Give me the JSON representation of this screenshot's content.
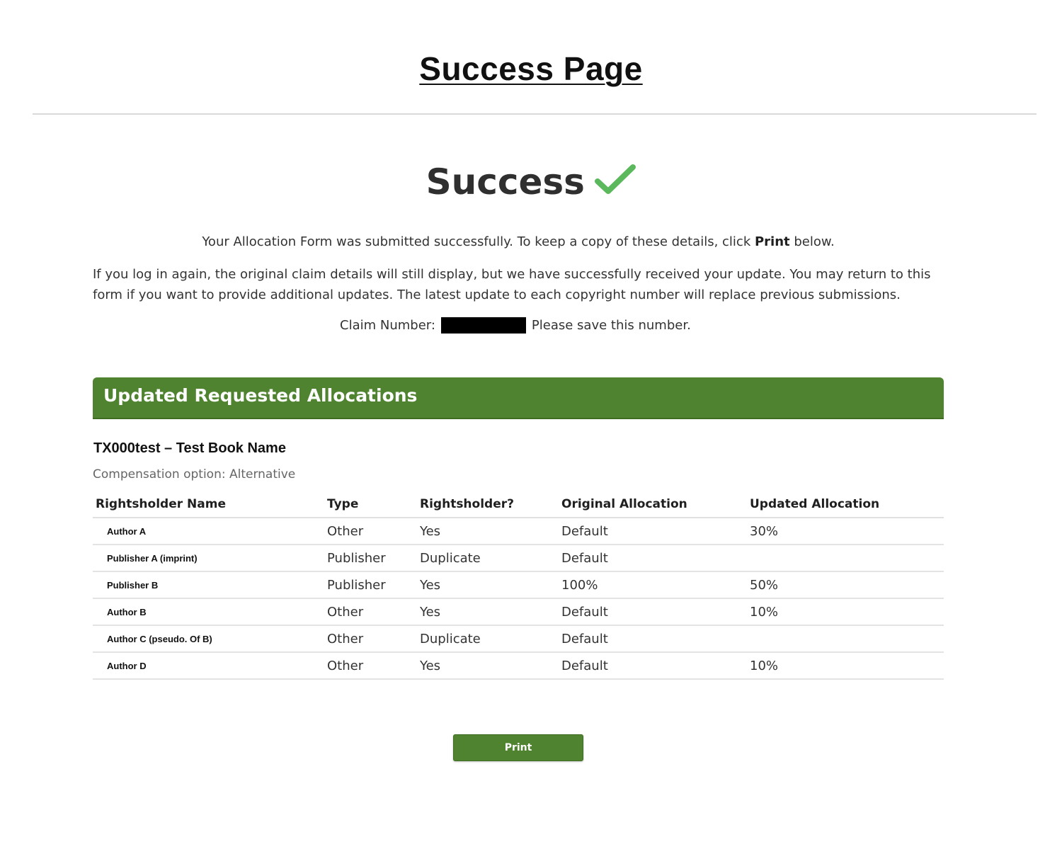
{
  "page": {
    "heading": "Success Page"
  },
  "success": {
    "title": "Success",
    "icon": "checkmark-icon",
    "check_color": "#5cb85c",
    "message_before": "Your Allocation Form was submitted successfully. To keep a copy of these details, click ",
    "message_bold": "Print",
    "message_after": " below.",
    "info": "If you log in again, the original claim details will still display, but we have successfully received your update. You may return to this form if you want to provide additional updates. The latest update to each copyright number will replace previous submissions.",
    "claim_label": "Claim Number:",
    "claim_note": "Please save this number."
  },
  "allocations": {
    "header": "Updated Requested Allocations",
    "accent_color": "#4f832f",
    "book_title": "TX000test – Test Book Name",
    "compensation_option": "Compensation option: Alternative",
    "columns": [
      "Rightsholder Name",
      "Type",
      "Rightsholder?",
      "Original Allocation",
      "Updated Allocation"
    ],
    "rows": [
      {
        "name": "Author A",
        "type": "Other",
        "rightsholder": "Yes",
        "original": "Default",
        "updated": "30%"
      },
      {
        "name": "Publisher A (imprint)",
        "type": "Publisher",
        "rightsholder": "Duplicate",
        "original": "Default",
        "updated": ""
      },
      {
        "name": "Publisher B",
        "type": "Publisher",
        "rightsholder": "Yes",
        "original": "100%",
        "updated": "50%"
      },
      {
        "name": "Author B",
        "type": "Other",
        "rightsholder": "Yes",
        "original": "Default",
        "updated": "10%"
      },
      {
        "name": "Author C (pseudo. Of B)",
        "type": "Other",
        "rightsholder": "Duplicate",
        "original": "Default",
        "updated": ""
      },
      {
        "name": "Author D",
        "type": "Other",
        "rightsholder": "Yes",
        "original": "Default",
        "updated": "10%"
      }
    ]
  },
  "actions": {
    "print_label": "Print"
  }
}
